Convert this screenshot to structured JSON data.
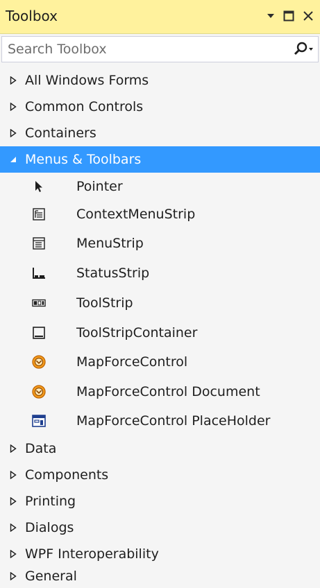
{
  "panel": {
    "title": "Toolbox",
    "search_placeholder": "Search Toolbox"
  },
  "groups_top": [
    {
      "label": "All Windows Forms",
      "expanded": false
    },
    {
      "label": "Common Controls",
      "expanded": false
    },
    {
      "label": "Containers",
      "expanded": false
    }
  ],
  "selected_group": {
    "label": "Menus & Toolbars",
    "expanded": true
  },
  "items": [
    {
      "label": "Pointer",
      "icon": "pointer-icon"
    },
    {
      "label": "ContextMenuStrip",
      "icon": "context-menu-strip-icon"
    },
    {
      "label": "MenuStrip",
      "icon": "menu-strip-icon"
    },
    {
      "label": "StatusStrip",
      "icon": "status-strip-icon"
    },
    {
      "label": "ToolStrip",
      "icon": "tool-strip-icon"
    },
    {
      "label": "ToolStripContainer",
      "icon": "tool-strip-container-icon"
    },
    {
      "label": "MapForceControl",
      "icon": "mapforce-icon"
    },
    {
      "label": "MapForceControl Document",
      "icon": "mapforce-icon"
    },
    {
      "label": "MapForceControl PlaceHolder",
      "icon": "placeholder-icon"
    }
  ],
  "groups_bottom": [
    {
      "label": "Data",
      "expanded": false
    },
    {
      "label": "Components",
      "expanded": false
    },
    {
      "label": "Printing",
      "expanded": false
    },
    {
      "label": "Dialogs",
      "expanded": false
    },
    {
      "label": "WPF Interoperability",
      "expanded": false
    },
    {
      "label": "General",
      "expanded": false
    }
  ],
  "colors": {
    "title_background": "#fff29d",
    "selection": "#3399ff",
    "mapforce_orange": "#f39a1c"
  }
}
